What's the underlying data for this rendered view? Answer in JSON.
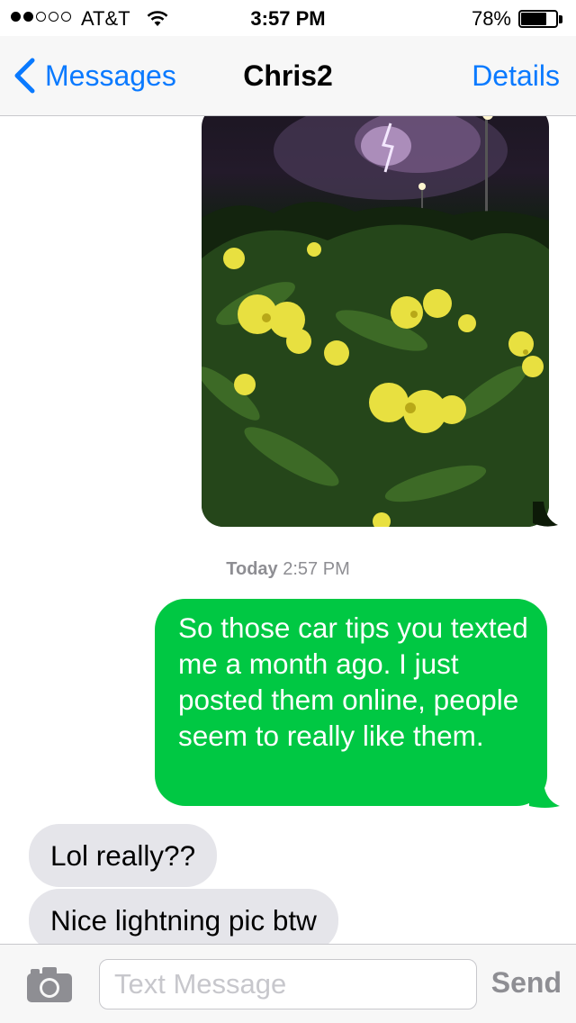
{
  "status_bar": {
    "signal_dots": 5,
    "signal_filled": 2,
    "carrier": "AT&T",
    "time": "3:57 PM",
    "battery_percent": "78%",
    "battery_level": 0.78
  },
  "nav": {
    "back_label": "Messages",
    "title": "Chris2",
    "details_label": "Details"
  },
  "thread": {
    "photo_attachment": "photo",
    "timestamp_day": "Today",
    "timestamp_time": "2:57 PM",
    "messages": [
      {
        "direction": "outgoing",
        "text": "So those car tips you texted me a month ago. I just posted them online, people seem to really like them."
      },
      {
        "direction": "incoming",
        "text": "Lol really??"
      },
      {
        "direction": "incoming",
        "text": "Nice lightning pic btw"
      }
    ]
  },
  "input": {
    "placeholder": "Text Message",
    "send_label": "Send"
  },
  "colors": {
    "accent": "#0a7aff",
    "outgoing_bubble": "#00c843",
    "incoming_bubble": "#e5e5ea",
    "secondary_text": "#8e8e93"
  },
  "icons": {
    "back": "chevron-left-icon",
    "camera": "camera-icon",
    "wifi": "wifi-icon",
    "battery": "battery-icon"
  }
}
